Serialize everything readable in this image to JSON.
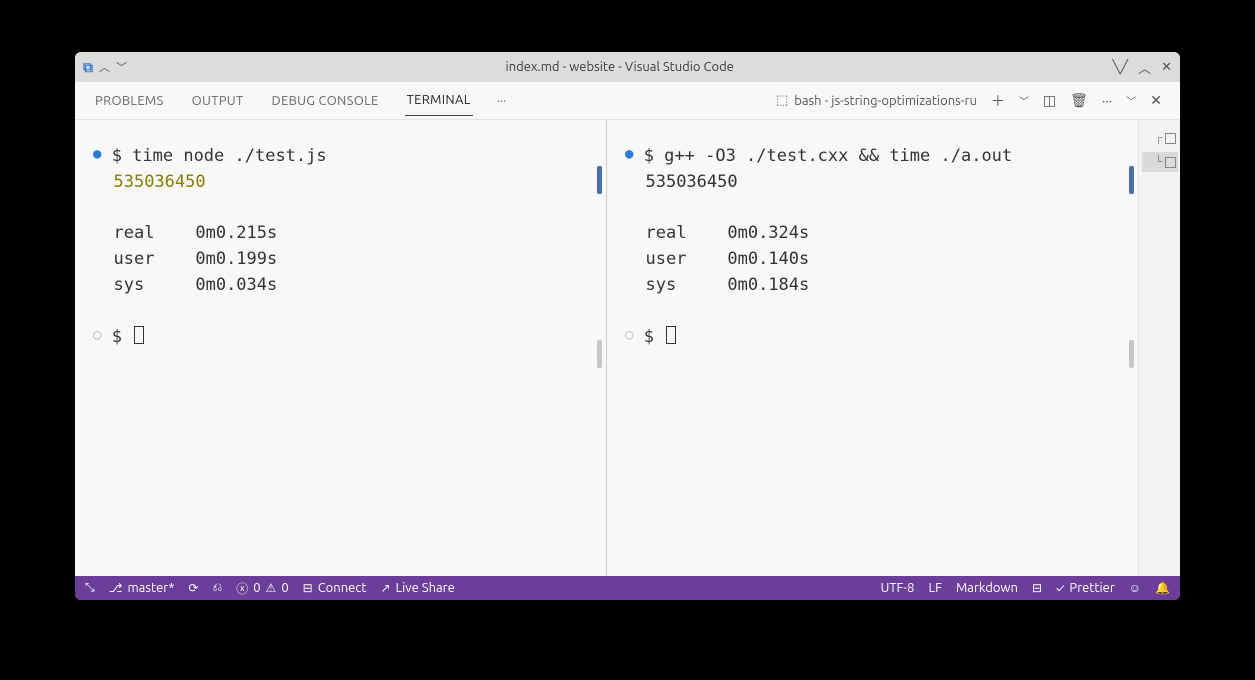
{
  "titlebar": {
    "title": "index.md - website - Visual Studio Code"
  },
  "panel": {
    "tabs": {
      "problems": "PROBLEMS",
      "output": "OUTPUT",
      "debug_console": "DEBUG CONSOLE",
      "terminal": "TERMINAL"
    },
    "shell_label": "bash - js-string-optimizations-ru"
  },
  "terminals": {
    "left": {
      "command": "$ time node ./test.js",
      "output_value": "535036450",
      "time_real": "real    0m0.215s",
      "time_user": "user    0m0.199s",
      "time_sys": "sys     0m0.034s",
      "prompt2": "$ "
    },
    "right": {
      "command": "$ g++ -O3 ./test.cxx && time ./a.out",
      "output_value": "535036450",
      "time_real": "real    0m0.324s",
      "time_user": "user    0m0.140s",
      "time_sys": "sys     0m0.184s",
      "prompt2": "$ "
    }
  },
  "statusbar": {
    "branch": "master*",
    "errors": "0",
    "warnings": "0",
    "connect": "Connect",
    "liveshare": "Live Share",
    "encoding": "UTF-8",
    "eol": "LF",
    "language": "Markdown",
    "prettier": "Prettier"
  }
}
